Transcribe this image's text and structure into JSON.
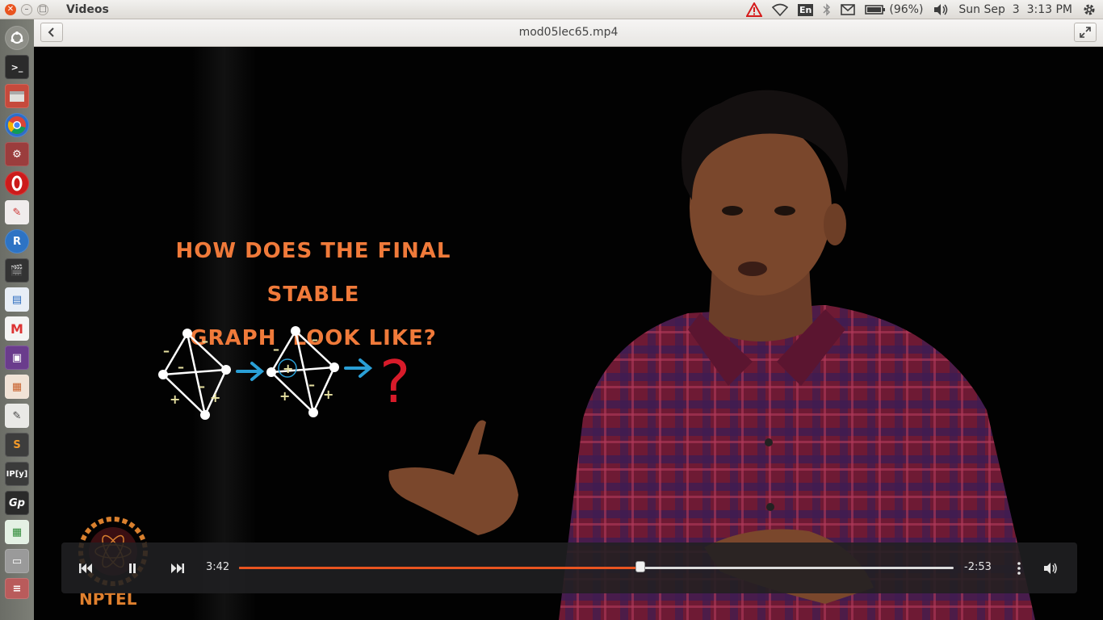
{
  "topbar": {
    "app_title": "Videos",
    "keyboard_layout": "En",
    "battery": "(96%)",
    "clock": "Sun Sep  3  3:13 PM"
  },
  "header": {
    "file_title": "mod05lec65.mp4"
  },
  "video_frame": {
    "board_line1": "HOW DOES THE FINAL STABLE",
    "board_line2": "GRAPH  LOOK LIKE?",
    "question_mark": "?",
    "logo_text": "NPTEL"
  },
  "controls": {
    "elapsed": "3:42",
    "remaining": "-2:53",
    "progress_fraction": 0.562
  },
  "colors": {
    "accent": "#e95420",
    "board_text": "#f07a3a",
    "arrow_blue": "#2a9fd6",
    "question_red": "#d81b2a"
  },
  "launcher": {
    "items": [
      "dash-icon",
      "terminal-icon",
      "files-icon",
      "chrome-icon",
      "settings-icon",
      "opera-icon",
      "document-viewer-icon",
      "r-icon",
      "video-editor-icon",
      "writer-icon",
      "gmail-icon",
      "media-icon",
      "presentation-icon",
      "text-editor-icon",
      "sublime-icon",
      "ipython-icon",
      "geogebra-icon",
      "spreadsheet-icon",
      "drive-icon",
      "tray-icon"
    ]
  }
}
